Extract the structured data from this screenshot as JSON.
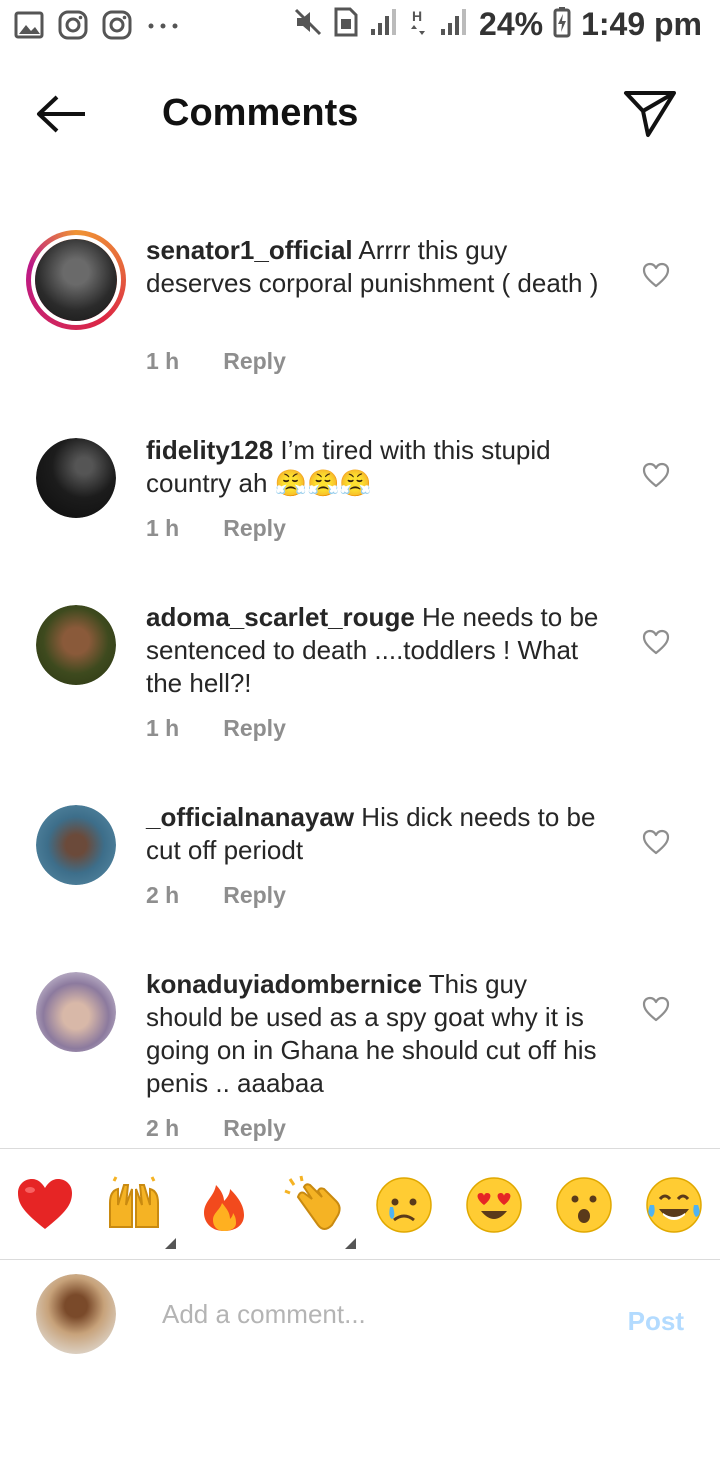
{
  "status_bar": {
    "battery": "24%",
    "time": "1:49 pm",
    "notif_icons": [
      "gallery-icon",
      "instagram-icon",
      "instagram-icon",
      "more-dots-icon"
    ],
    "system_icons": [
      "mute-icon",
      "sim-icon",
      "signal-icon",
      "hplus-data-icon",
      "signal-icon",
      "battery-charging-icon"
    ]
  },
  "header": {
    "title": "Comments",
    "back_icon": "arrow-left-icon",
    "share_icon": "direct-send-icon"
  },
  "comments": [
    {
      "username": "senator1_official",
      "text": " Arrrr this guy deserves corporal punishment ( death )",
      "time": "1 h",
      "reply_label": "Reply",
      "story_ring": true,
      "avatar_color": "#3a3a3a"
    },
    {
      "username": "fidelity128",
      "text": " I’m tired with this stupid country ah 😤😤😤",
      "time": "1 h",
      "reply_label": "Reply",
      "story_ring": false,
      "avatar_color": "#1c1c1c"
    },
    {
      "username": "adoma_scarlet_rouge",
      "text": " He needs to be sentenced to death ....toddlers ! What the hell?!",
      "time": "1 h",
      "reply_label": "Reply",
      "story_ring": false,
      "avatar_color": "#4d5a2a"
    },
    {
      "username": "_officialnanayaw",
      "text": " His dick needs to be cut off periodt",
      "time": "2 h",
      "reply_label": "Reply",
      "story_ring": false,
      "avatar_color": "#3d6e8a"
    },
    {
      "username": "konaduyiadombernice",
      "text": " This guy should be used as a spy goat why it is going on in Ghana he should cut off his penis .. aaabaa",
      "time": "2 h",
      "reply_label": "Reply",
      "story_ring": false,
      "avatar_color": "#8c7a9e"
    }
  ],
  "reactions": [
    {
      "emoji": "❤️",
      "name": "red-heart-emoji",
      "has_variants": false
    },
    {
      "emoji": "🙌",
      "name": "raising-hands-emoji",
      "has_variants": true
    },
    {
      "emoji": "🔥",
      "name": "fire-emoji",
      "has_variants": false
    },
    {
      "emoji": "👏",
      "name": "clapping-hands-emoji",
      "has_variants": true
    },
    {
      "emoji": "😢",
      "name": "crying-face-emoji",
      "has_variants": false
    },
    {
      "emoji": "😍",
      "name": "heart-eyes-emoji",
      "has_variants": false
    },
    {
      "emoji": "😮",
      "name": "surprised-face-emoji",
      "has_variants": false
    },
    {
      "emoji": "😂",
      "name": "tears-of-joy-emoji",
      "has_variants": false
    }
  ],
  "compose": {
    "placeholder": "Add a comment...",
    "post_label": "Post",
    "avatar_color": "#c7a27a"
  },
  "colors": {
    "text": "#262626",
    "muted": "#8e8e8e",
    "post_disabled": "#b3dbff",
    "divider": "#dbdbdb"
  }
}
